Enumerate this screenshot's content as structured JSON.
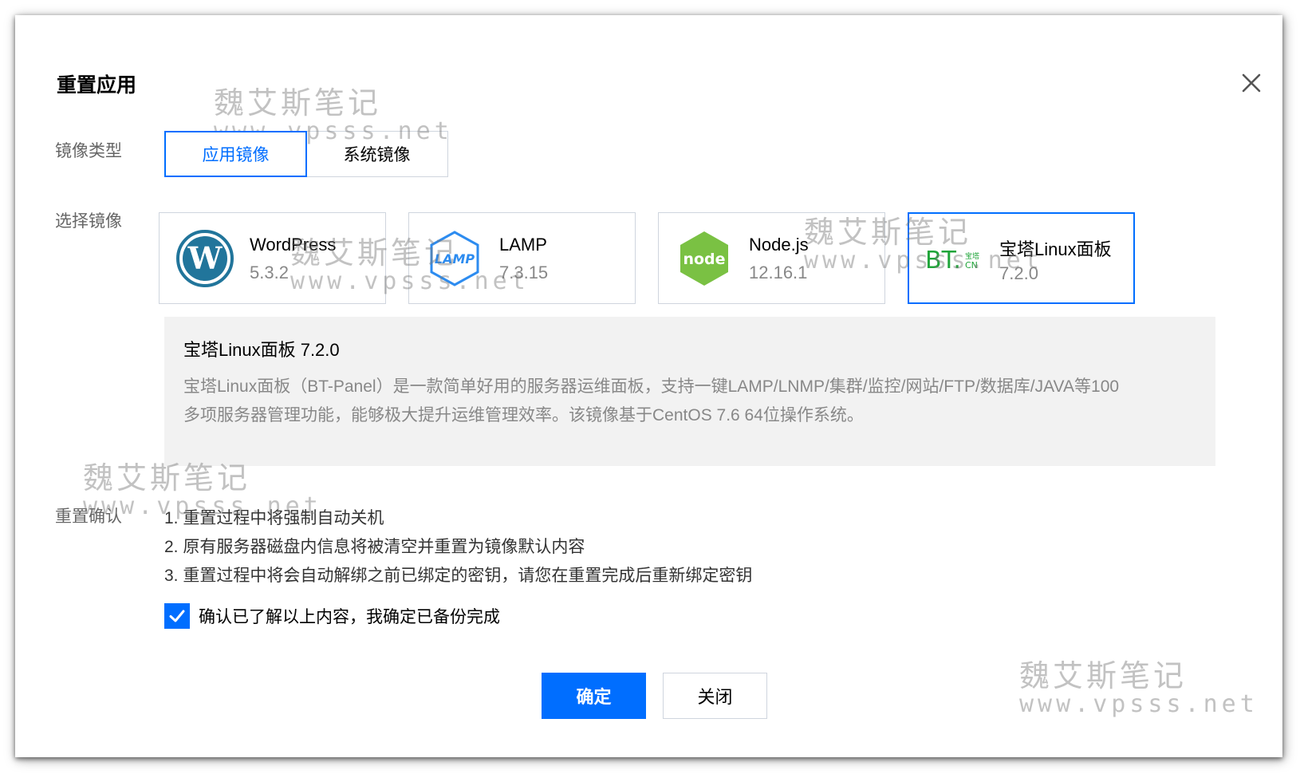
{
  "dialog": {
    "title": "重置应用",
    "close_icon": "close-icon"
  },
  "image_type": {
    "label": "镜像类型",
    "options": [
      "应用镜像",
      "系统镜像"
    ],
    "selected": "应用镜像"
  },
  "select_image": {
    "label": "选择镜像",
    "cards": [
      {
        "name": "WordPress",
        "version": "5.3.2",
        "icon": "wordpress-icon"
      },
      {
        "name": "LAMP",
        "version": "7.3.15",
        "icon": "lamp-icon"
      },
      {
        "name": "Node.js",
        "version": "12.16.1",
        "icon": "nodejs-icon"
      },
      {
        "name": "宝塔Linux面板",
        "version": "7.2.0",
        "icon": "bt-panel-icon",
        "selected": true
      }
    ]
  },
  "description": {
    "title": "宝塔Linux面板 7.2.0",
    "text": "宝塔Linux面板（BT-Panel）是一款简单好用的服务器运维面板，支持一键LAMP/LNMP/集群/监控/网站/FTP/数据库/JAVA等100多项服务器管理功能，能够极大提升运维管理效率。该镜像基于CentOS 7.6 64位操作系统。"
  },
  "reset_confirm": {
    "label": "重置确认",
    "items": [
      "1. 重置过程中将强制自动关机",
      "2. 原有服务器磁盘内信息将被清空并重置为镜像默认内容",
      "3. 重置过程中将会自动解绑之前已绑定的密钥，请您在重置完成后重新绑定密钥"
    ],
    "checkbox_label": "确认已了解以上内容，我确定已备份完成",
    "checked": true
  },
  "buttons": {
    "confirm": "确定",
    "close": "关闭"
  },
  "watermark": {
    "cn": "魏艾斯笔记",
    "en": "www.vpsss.net"
  },
  "colors": {
    "primary": "#006eff",
    "border": "#cfd5de",
    "desc_bg": "#f2f2f2",
    "nodejs_green": "#7ac143",
    "wordpress_blue": "#21759b",
    "bt_green": "#20a53a"
  }
}
